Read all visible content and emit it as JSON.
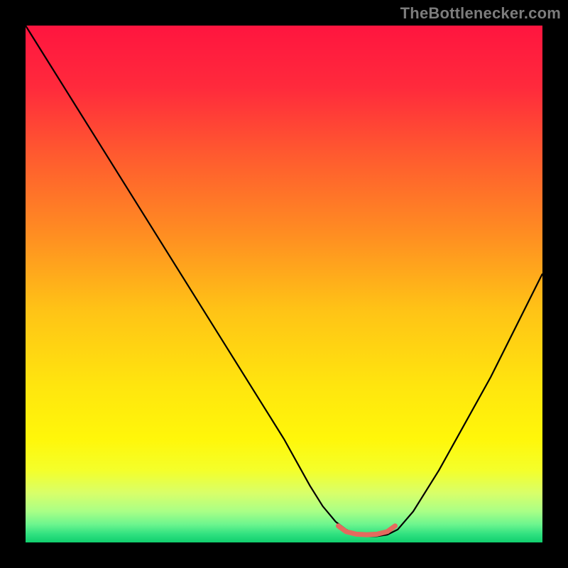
{
  "watermark": {
    "text": "TheBottlenecker.com"
  },
  "chart_data": {
    "type": "line",
    "title": "",
    "xlabel": "",
    "ylabel": "",
    "xlim": [
      0,
      100
    ],
    "ylim": [
      0,
      100
    ],
    "grid": false,
    "legend": false,
    "background_gradient": {
      "stops": [
        {
          "offset": 0.0,
          "color": "#ff153f"
        },
        {
          "offset": 0.12,
          "color": "#ff2a3c"
        },
        {
          "offset": 0.25,
          "color": "#ff5a2f"
        },
        {
          "offset": 0.4,
          "color": "#ff8c22"
        },
        {
          "offset": 0.55,
          "color": "#ffc316"
        },
        {
          "offset": 0.7,
          "color": "#ffe60e"
        },
        {
          "offset": 0.8,
          "color": "#fff70a"
        },
        {
          "offset": 0.86,
          "color": "#f4ff2a"
        },
        {
          "offset": 0.905,
          "color": "#d8ff6a"
        },
        {
          "offset": 0.94,
          "color": "#a9ff86"
        },
        {
          "offset": 0.965,
          "color": "#6cf58e"
        },
        {
          "offset": 0.985,
          "color": "#2de07f"
        },
        {
          "offset": 1.0,
          "color": "#11cf6e"
        }
      ]
    },
    "curve": {
      "color": "#000000",
      "width": 2.2,
      "x": [
        0,
        5,
        10,
        15,
        20,
        25,
        30,
        35,
        40,
        45,
        50,
        55,
        57.5,
        60,
        62,
        64,
        66,
        68,
        70,
        72,
        75,
        80,
        85,
        90,
        95,
        100
      ],
      "y": [
        100,
        92,
        84,
        76,
        68,
        60,
        52,
        44,
        36,
        28,
        20,
        11,
        7,
        4,
        2.5,
        1.5,
        1.2,
        1.2,
        1.5,
        2.5,
        6,
        14,
        23,
        32,
        42,
        52
      ]
    },
    "flat_marker": {
      "color": "#e46a5e",
      "width": 7,
      "x": [
        60.5,
        62,
        64,
        66,
        68,
        70,
        71.5
      ],
      "y": [
        3.2,
        2.1,
        1.6,
        1.5,
        1.6,
        2.1,
        3.2
      ]
    }
  }
}
